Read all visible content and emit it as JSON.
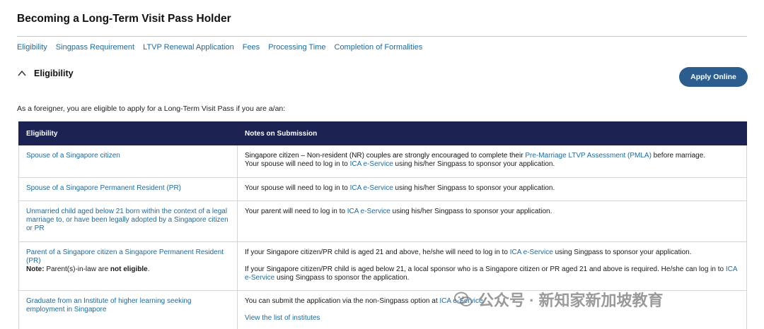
{
  "page": {
    "title": "Becoming a Long-Term Visit Pass Holder",
    "nav": [
      "Eligibility",
      "Singpass Requirement",
      "LTVP Renewal Application",
      "Fees",
      "Processing Time",
      "Completion of Formalities"
    ]
  },
  "section": {
    "title": "Eligibility",
    "apply_label": "Apply Online",
    "intro": "As a foreigner, you are eligible to apply for a Long-Term Visit Pass if you are a/an:"
  },
  "table": {
    "headers": [
      "Eligibility",
      "Notes on Submission"
    ],
    "rows": [
      {
        "eligibility": "Spouse of a Singapore citizen",
        "notes": {
          "p1_a": "Singapore citizen – Non-resident (NR) couples are strongly encouraged to complete their ",
          "p1_link": "Pre-Marriage LTVP Assessment (PMLA)",
          "p1_b": " before marriage.",
          "p2_a": "Your spouse will need to log in to ",
          "p2_link": "ICA e-Service",
          "p2_b": " using his/her Singpass to sponsor your application."
        }
      },
      {
        "eligibility": "Spouse of a Singapore Permanent Resident (PR)",
        "notes": {
          "p1_a": "Your spouse will need to log in to ",
          "p1_link": "ICA e-Service",
          "p1_b": " using his/her Singpass to sponsor your application."
        }
      },
      {
        "eligibility": "Unmarried child aged below 21 born within the context of a legal marriage to, or have been legally adopted by a Singapore citizen or PR",
        "notes": {
          "p1_a": "Your parent will need to log in to ",
          "p1_link": "ICA e-Service",
          "p1_b": " using his/her Singpass to sponsor your application."
        }
      },
      {
        "eligibility": "Parent of a Singapore citizen a Singapore Permanent Resident (PR)",
        "note_label": "Note:",
        "note_mid": " Parent(s)-in-law are ",
        "note_bold": "not eligible",
        "note_end": ".",
        "notes": {
          "p1_a": "If your Singapore citizen/PR child is aged 21 and above, he/she will need to log in to ",
          "p1_link": "ICA e-Service",
          "p1_b": " using Singpass to sponsor your application.",
          "p2_a": "If your Singapore citizen/PR child is aged below 21, a local sponsor who is a Singapore citizen or PR aged 21 and above is required. He/she can log in to ",
          "p2_link": "ICA e-Service",
          "p2_b": " using Singpass to sponsor the application."
        }
      },
      {
        "eligibility": "Graduate from an Institute of higher learning seeking employment in Singapore",
        "notes": {
          "p1_a": "You can submit the application via the non-Singpass option at ",
          "p1_link": "ICA e-Service",
          "p1_b": ".",
          "p2_link": "View the list of institutes"
        }
      }
    ]
  },
  "watermark": {
    "text": "公众号 · 新知家新加坡教育"
  },
  "colors": {
    "link": "#1e6aa1",
    "header_bg": "#1c2353",
    "button_bg": "#2b5d8f"
  }
}
